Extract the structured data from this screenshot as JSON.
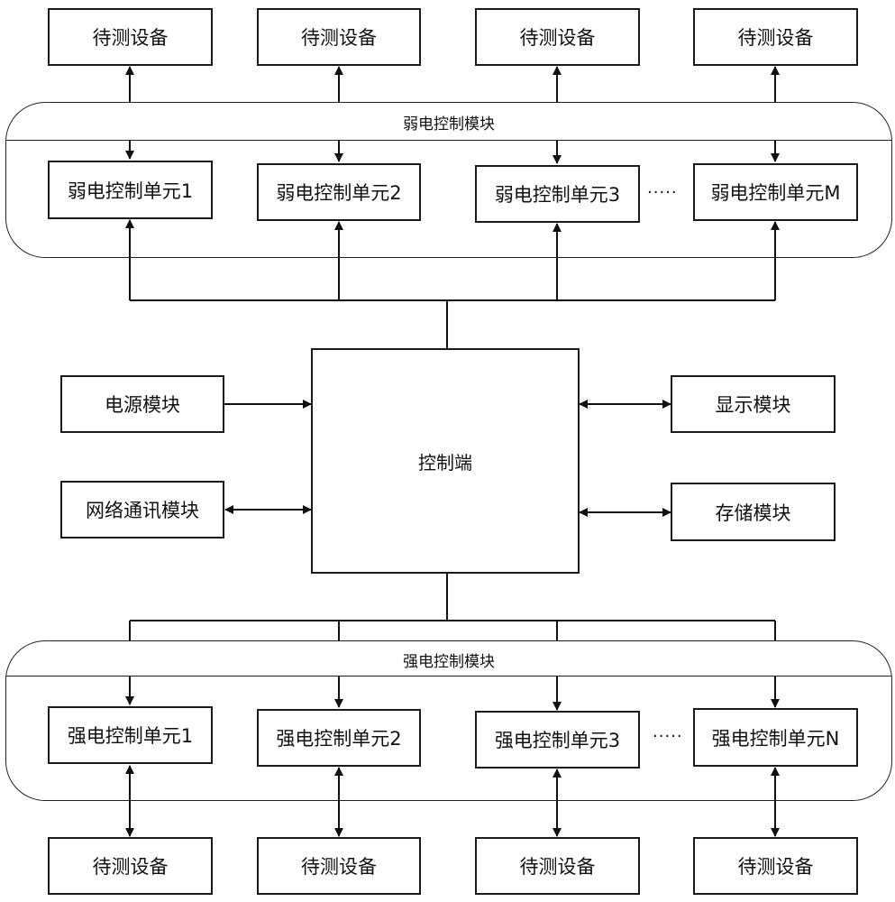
{
  "diagram": {
    "weak_module": {
      "title": "弱电控制模块",
      "units": [
        "弱电控制单元1",
        "弱电控制单元2",
        "弱电控制单元3",
        "弱电控制单元M"
      ],
      "ellipsis": "·····",
      "devices": [
        "待测设备",
        "待测设备",
        "待测设备",
        "待测设备"
      ]
    },
    "controller": {
      "title": "控制端",
      "left": [
        {
          "label": "电源模块",
          "connection": "one-way-to-controller"
        },
        {
          "label": "网络通讯模块",
          "connection": "bidirectional"
        }
      ],
      "right": [
        {
          "label": "显示模块",
          "connection": "bidirectional"
        },
        {
          "label": "存储模块",
          "connection": "bidirectional"
        }
      ]
    },
    "strong_module": {
      "title": "强电控制模块",
      "units": [
        "强电控制单元1",
        "强电控制单元2",
        "强电控制单元3",
        "强电控制单元N"
      ],
      "ellipsis": "·····",
      "devices": [
        "待测设备",
        "待测设备",
        "待测设备",
        "待测设备"
      ]
    }
  }
}
